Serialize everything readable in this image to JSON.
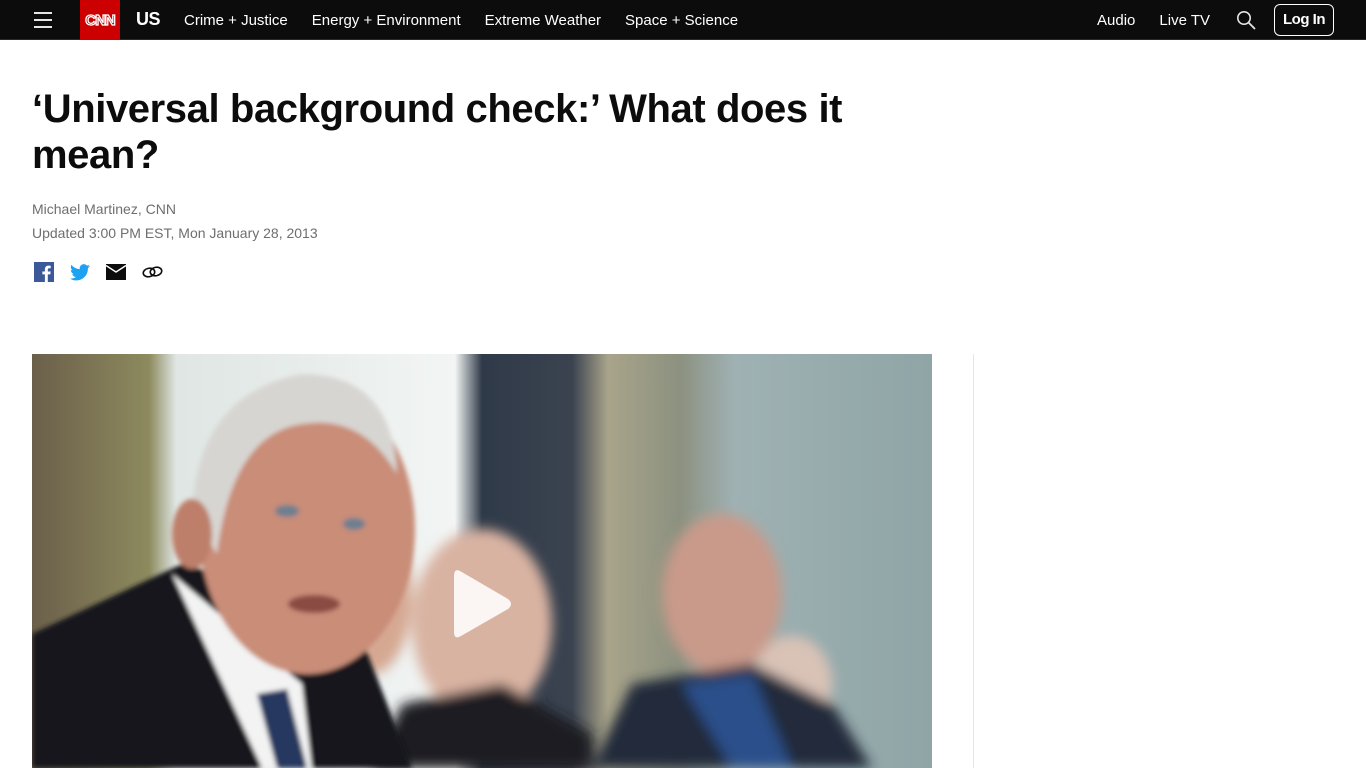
{
  "nav": {
    "menu_icon": "hamburger-menu-icon",
    "logo": "CNN",
    "section": "US",
    "links": [
      "Crime + Justice",
      "Energy + Environment",
      "Extreme Weather",
      "Space + Science"
    ],
    "right_links": {
      "audio": "Audio",
      "live_tv": "Live TV"
    },
    "search_icon": "search-icon",
    "login_label": "Log In"
  },
  "article": {
    "headline": "‘Universal background check:’ What does it mean?",
    "byline": "Michael Martinez, CNN",
    "timestamp": "Updated 3:00 PM EST, Mon January 28, 2013",
    "share": [
      "facebook-icon",
      "twitter-icon",
      "email-icon",
      "copy-link-icon"
    ]
  },
  "media": {
    "type": "video",
    "play_icon": "play-icon",
    "description": "Photo of a man in a dark suit speaking at a meeting with others blurred in background"
  },
  "colors": {
    "nav_bg": "#0c0c0c",
    "brand_red": "#cc0000",
    "facebook": "#3b5998",
    "twitter": "#1da1f2",
    "meta_text": "#6e6e6e"
  }
}
